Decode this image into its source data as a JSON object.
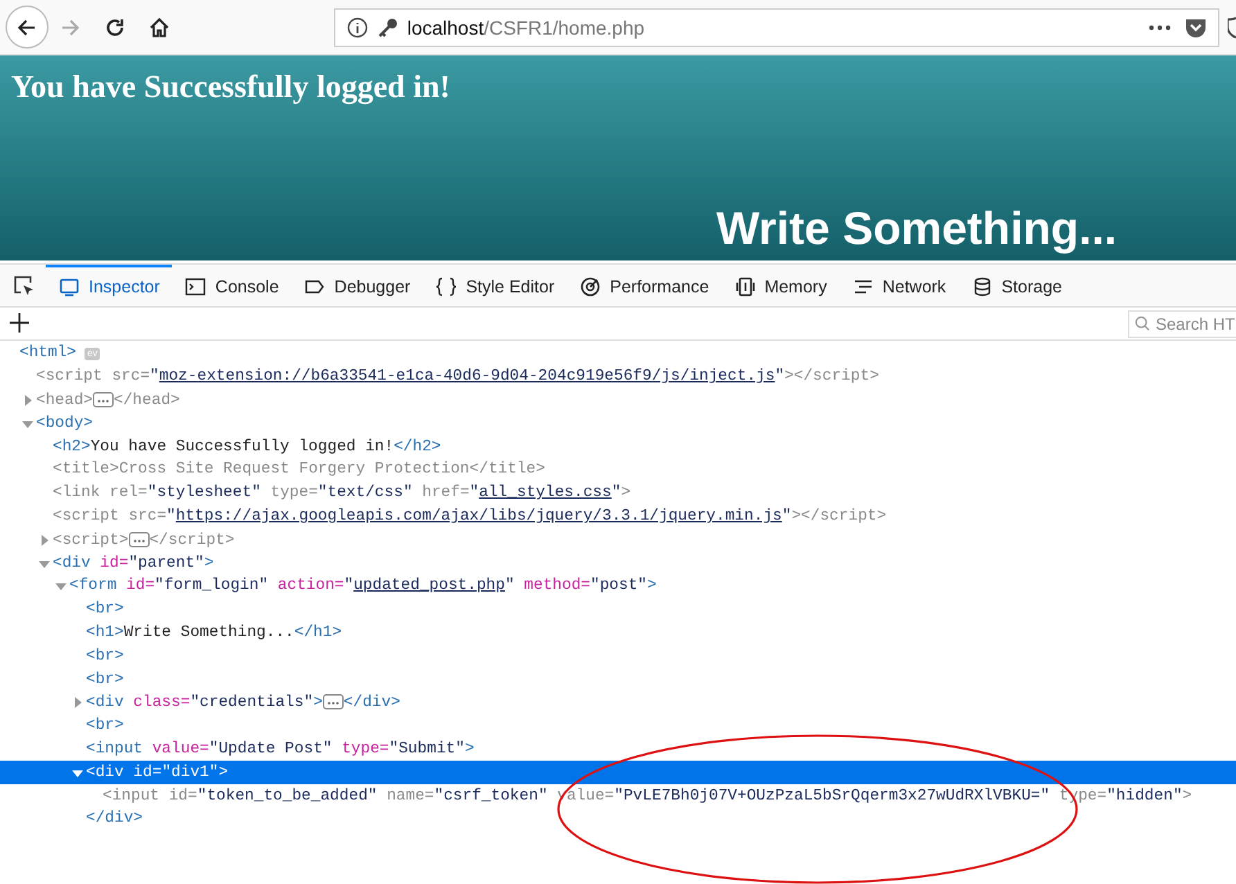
{
  "browser": {
    "url_host": "localhost",
    "url_path": "/CSFR1/home.php"
  },
  "page": {
    "heading": "You have Successfully logged in!",
    "subheading": "Write Something..."
  },
  "devtools": {
    "tabs": [
      {
        "label": "Inspector",
        "kind": "inspector",
        "selected": true
      },
      {
        "label": "Console",
        "kind": "console",
        "selected": false
      },
      {
        "label": "Debugger",
        "kind": "debugger",
        "selected": false
      },
      {
        "label": "Style Editor",
        "kind": "braces",
        "selected": false
      },
      {
        "label": "Performance",
        "kind": "performance",
        "selected": false
      },
      {
        "label": "Memory",
        "kind": "memory",
        "selected": false
      },
      {
        "label": "Network",
        "kind": "network",
        "selected": false
      },
      {
        "label": "Storage",
        "kind": "storage",
        "selected": false
      }
    ],
    "search": {
      "placeholder": "Search HT"
    },
    "tree": [
      {
        "dim": false,
        "selected": false,
        "tokens": [
          {
            "kind": "tag",
            "text": "<html>"
          },
          {
            "kind": "event",
            "text": "ev"
          }
        ],
        "children": [
          {
            "dim": true,
            "selected": false,
            "tokens": [
              {
                "kind": "tag",
                "text": "<script"
              },
              {
                "kind": "attr",
                "text": " src="
              },
              {
                "kind": "value",
                "text": "\""
              },
              {
                "kind": "link",
                "text": "moz-extension://b6a33541-e1ca-40d6-9d04-204c919e56f9/js/inject.js"
              },
              {
                "kind": "value",
                "text": "\""
              },
              {
                "kind": "tag",
                "text": "></script>"
              }
            ]
          },
          {
            "dim": true,
            "selected": false,
            "expanded": false,
            "tokens": [
              {
                "kind": "tag",
                "text": "<head>"
              },
              {
                "kind": "more"
              },
              {
                "kind": "tag",
                "text": "</head>"
              }
            ]
          },
          {
            "dim": false,
            "selected": false,
            "expanded": true,
            "tokens": [
              {
                "kind": "tag",
                "text": "<body>"
              }
            ],
            "children": [
              {
                "dim": false,
                "selected": false,
                "tokens": [
                  {
                    "kind": "tag",
                    "text": "<h2>"
                  },
                  {
                    "kind": "text",
                    "text": "You have Successfully logged in!"
                  },
                  {
                    "kind": "tag",
                    "text": "</h2>"
                  }
                ]
              },
              {
                "dim": true,
                "selected": false,
                "tokens": [
                  {
                    "kind": "tag",
                    "text": "<title>"
                  },
                  {
                    "kind": "text",
                    "text": "Cross Site Request Forgery Protection"
                  },
                  {
                    "kind": "tag",
                    "text": "</title>"
                  }
                ]
              },
              {
                "dim": true,
                "selected": false,
                "tokens": [
                  {
                    "kind": "tag",
                    "text": "<link"
                  },
                  {
                    "kind": "attr",
                    "text": " rel="
                  },
                  {
                    "kind": "value",
                    "text": "\"stylesheet\""
                  },
                  {
                    "kind": "attr",
                    "text": " type="
                  },
                  {
                    "kind": "value",
                    "text": "\"text/css\""
                  },
                  {
                    "kind": "attr",
                    "text": " href="
                  },
                  {
                    "kind": "value",
                    "text": "\""
                  },
                  {
                    "kind": "link",
                    "text": "all_styles.css"
                  },
                  {
                    "kind": "value",
                    "text": "\""
                  },
                  {
                    "kind": "tag",
                    "text": ">"
                  }
                ]
              },
              {
                "dim": true,
                "selected": false,
                "tokens": [
                  {
                    "kind": "tag",
                    "text": "<script"
                  },
                  {
                    "kind": "attr",
                    "text": " src="
                  },
                  {
                    "kind": "value",
                    "text": "\""
                  },
                  {
                    "kind": "link",
                    "text": "https://ajax.googleapis.com/ajax/libs/jquery/3.3.1/jquery.min.js"
                  },
                  {
                    "kind": "value",
                    "text": "\""
                  },
                  {
                    "kind": "tag",
                    "text": "></script>"
                  }
                ]
              },
              {
                "dim": true,
                "selected": false,
                "expanded": false,
                "tokens": [
                  {
                    "kind": "tag",
                    "text": "<script>"
                  },
                  {
                    "kind": "more"
                  },
                  {
                    "kind": "tag",
                    "text": "</script>"
                  }
                ]
              },
              {
                "dim": false,
                "selected": false,
                "expanded": true,
                "tokens": [
                  {
                    "kind": "tag",
                    "text": "<div"
                  },
                  {
                    "kind": "attr",
                    "text": " id="
                  },
                  {
                    "kind": "value",
                    "text": "\"parent\""
                  },
                  {
                    "kind": "tag",
                    "text": ">"
                  }
                ],
                "children": [
                  {
                    "dim": false,
                    "selected": false,
                    "expanded": true,
                    "tokens": [
                      {
                        "kind": "tag",
                        "text": "<form"
                      },
                      {
                        "kind": "attr",
                        "text": " id="
                      },
                      {
                        "kind": "value",
                        "text": "\"form_login\""
                      },
                      {
                        "kind": "attr",
                        "text": " action="
                      },
                      {
                        "kind": "value",
                        "text": "\""
                      },
                      {
                        "kind": "link",
                        "text": "updated_post.php"
                      },
                      {
                        "kind": "value",
                        "text": "\""
                      },
                      {
                        "kind": "attr",
                        "text": " method="
                      },
                      {
                        "kind": "value",
                        "text": "\"post\""
                      },
                      {
                        "kind": "tag",
                        "text": ">"
                      }
                    ],
                    "children": [
                      {
                        "dim": false,
                        "selected": false,
                        "tokens": [
                          {
                            "kind": "tag",
                            "text": "<br>"
                          }
                        ]
                      },
                      {
                        "dim": false,
                        "selected": false,
                        "tokens": [
                          {
                            "kind": "tag",
                            "text": "<h1>"
                          },
                          {
                            "kind": "text",
                            "text": "Write Something..."
                          },
                          {
                            "kind": "tag",
                            "text": "</h1>"
                          }
                        ]
                      },
                      {
                        "dim": false,
                        "selected": false,
                        "tokens": [
                          {
                            "kind": "tag",
                            "text": "<br>"
                          }
                        ]
                      },
                      {
                        "dim": false,
                        "selected": false,
                        "tokens": [
                          {
                            "kind": "tag",
                            "text": "<br>"
                          }
                        ]
                      },
                      {
                        "dim": false,
                        "selected": false,
                        "expanded": false,
                        "tokens": [
                          {
                            "kind": "tag",
                            "text": "<div"
                          },
                          {
                            "kind": "attr",
                            "text": " class="
                          },
                          {
                            "kind": "value",
                            "text": "\"credentials\""
                          },
                          {
                            "kind": "tag",
                            "text": ">"
                          },
                          {
                            "kind": "more"
                          },
                          {
                            "kind": "tag",
                            "text": "</div>"
                          }
                        ]
                      },
                      {
                        "dim": false,
                        "selected": false,
                        "tokens": [
                          {
                            "kind": "tag",
                            "text": "<br>"
                          }
                        ]
                      },
                      {
                        "dim": false,
                        "selected": false,
                        "tokens": [
                          {
                            "kind": "tag",
                            "text": "<input"
                          },
                          {
                            "kind": "attr",
                            "text": " value="
                          },
                          {
                            "kind": "value",
                            "text": "\"Update Post\""
                          },
                          {
                            "kind": "attr",
                            "text": " type="
                          },
                          {
                            "kind": "value",
                            "text": "\"Submit\""
                          },
                          {
                            "kind": "tag",
                            "text": ">"
                          }
                        ]
                      },
                      {
                        "dim": false,
                        "selected": true,
                        "expanded": true,
                        "closing": "</div>",
                        "tokens": [
                          {
                            "kind": "tag",
                            "text": "<div"
                          },
                          {
                            "kind": "attr",
                            "text": " id="
                          },
                          {
                            "kind": "value",
                            "text": "\"div1\""
                          },
                          {
                            "kind": "tag",
                            "text": ">"
                          }
                        ],
                        "children": [
                          {
                            "dim": true,
                            "selected": false,
                            "tokens": [
                              {
                                "kind": "tag",
                                "text": "<input"
                              },
                              {
                                "kind": "attr",
                                "text": " id="
                              },
                              {
                                "kind": "value",
                                "text": "\"token_to_be_added\""
                              },
                              {
                                "kind": "attr",
                                "text": " name="
                              },
                              {
                                "kind": "value",
                                "text": "\"csrf_token\""
                              },
                              {
                                "kind": "attr",
                                "text": " value="
                              },
                              {
                                "kind": "value",
                                "text": "\"PvLE7Bh0j07V+OUzPzaL5bSrQqerm3x27wUdRXlVBKU=\""
                              },
                              {
                                "kind": "attr",
                                "text": " type="
                              },
                              {
                                "kind": "value",
                                "text": "\"hidden\""
                              },
                              {
                                "kind": "tag",
                                "text": ">"
                              }
                            ]
                          }
                        ]
                      }
                    ]
                  }
                ]
              }
            ]
          }
        ]
      }
    ]
  }
}
